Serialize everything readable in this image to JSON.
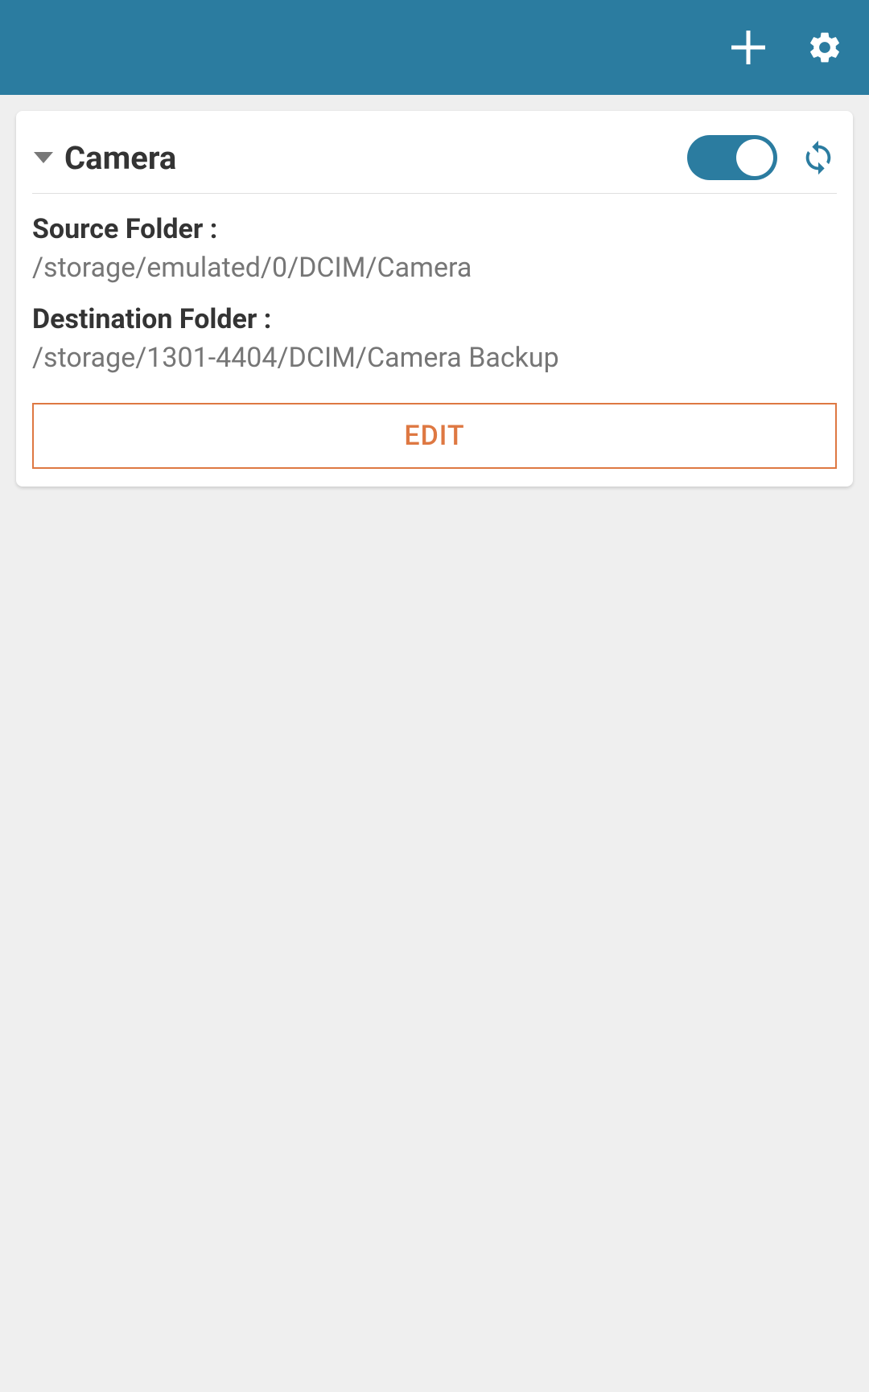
{
  "header": {
    "add_icon": "plus-icon",
    "settings_icon": "gear-icon"
  },
  "card": {
    "title": "Camera",
    "toggle_enabled": true,
    "source_label": "Source Folder :",
    "source_value": "/storage/emulated/0/DCIM/Camera",
    "destination_label": "Destination Folder :",
    "destination_value": "/storage/1301-4404/DCIM/Camera Backup",
    "edit_button_label": "EDIT"
  },
  "colors": {
    "primary": "#2b7ca0",
    "accent": "#de7842",
    "background": "#efefef",
    "card_bg": "#ffffff",
    "text_dark": "#343434",
    "text_muted": "#767676"
  }
}
